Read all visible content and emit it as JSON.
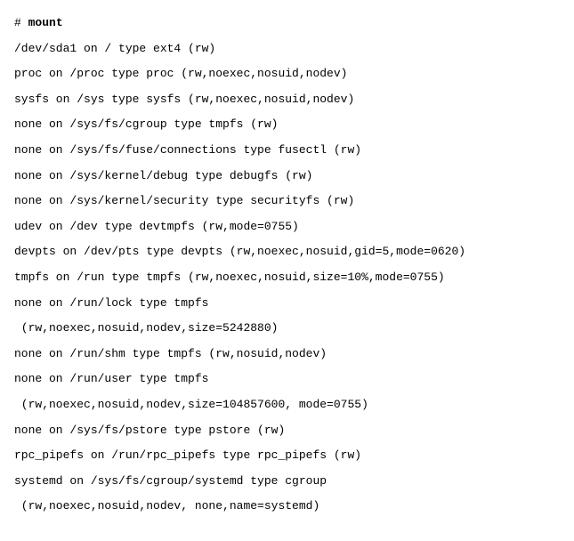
{
  "lines": [
    {
      "text": "# mount",
      "bold_cmd": true
    },
    {
      "text": "/dev/sda1 on / type ext4 (rw)"
    },
    {
      "text": "proc on /proc type proc (rw,noexec,nosuid,nodev)"
    },
    {
      "text": "sysfs on /sys type sysfs (rw,noexec,nosuid,nodev)"
    },
    {
      "text": "none on /sys/fs/cgroup type tmpfs (rw)"
    },
    {
      "text": "none on /sys/fs/fuse/connections type fusectl (rw)"
    },
    {
      "text": "none on /sys/kernel/debug type debugfs (rw)"
    },
    {
      "text": "none on /sys/kernel/security type securityfs (rw)"
    },
    {
      "text": "udev on /dev type devtmpfs (rw,mode=0755)"
    },
    {
      "text": "devpts on /dev/pts type devpts (rw,noexec,nosuid,gid=5,mode=0620)"
    },
    {
      "text": "tmpfs on /run type tmpfs (rw,noexec,nosuid,size=10%,mode=0755)"
    },
    {
      "text": "none on /run/lock type tmpfs"
    },
    {
      "text": " (rw,noexec,nosuid,nodev,size=5242880)",
      "indent": true
    },
    {
      "text": "none on /run/shm type tmpfs (rw,nosuid,nodev)"
    },
    {
      "text": "none on /run/user type tmpfs"
    },
    {
      "text": " (rw,noexec,nosuid,nodev,size=104857600, mode=0755)",
      "indent": true
    },
    {
      "text": "none on /sys/fs/pstore type pstore (rw)"
    },
    {
      "text": "rpc_pipefs on /run/rpc_pipefs type rpc_pipefs (rw)"
    },
    {
      "text": "systemd on /sys/fs/cgroup/systemd type cgroup"
    },
    {
      "text": " (rw,noexec,nosuid,nodev, none,name=systemd)",
      "indent": true
    }
  ],
  "prompt_prefix": "# ",
  "prompt_command": "mount"
}
